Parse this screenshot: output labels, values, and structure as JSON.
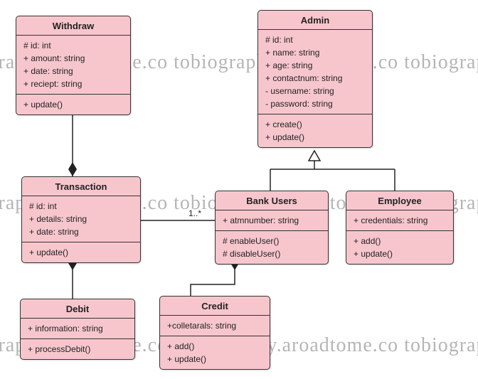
{
  "watermark": "tobiography.aroadtome.co   tobiography.aroadtome.co   tobiography.aroadtome.co",
  "multiplicity": {
    "bankusers_transaction": "1..*"
  },
  "classes": {
    "withdraw": {
      "name": "Withdraw",
      "attrs": [
        "# id: int",
        "+ amount: string",
        "+ date: string",
        "+ reciept: string"
      ],
      "methods": [
        "+ update()"
      ]
    },
    "admin": {
      "name": "Admin",
      "attrs": [
        "# id: int",
        "+ name: string",
        "+ age: string",
        "+ contactnum: string",
        "- username: string",
        "- password: string"
      ],
      "methods": [
        "+ create()",
        "+ update()"
      ]
    },
    "transaction": {
      "name": "Transaction",
      "attrs": [
        "# id: int",
        "+ details: string",
        "+ date: string"
      ],
      "methods": [
        "+ update()"
      ]
    },
    "bankusers": {
      "name": "Bank Users",
      "attrs": [
        "+ atmnumber: string"
      ],
      "methods": [
        "# enableUser()",
        "# disableUser()"
      ]
    },
    "employee": {
      "name": "Employee",
      "attrs": [
        "+ credentials: string"
      ],
      "methods": [
        "+ add()",
        "+ update()"
      ]
    },
    "debit": {
      "name": "Debit",
      "attrs": [
        "+ information: string"
      ],
      "methods": [
        "+ processDebit()"
      ]
    },
    "credit": {
      "name": "Credit",
      "attrs": [
        "+colletarals: string"
      ],
      "methods": [
        "+ add()",
        "+ update()"
      ]
    }
  }
}
